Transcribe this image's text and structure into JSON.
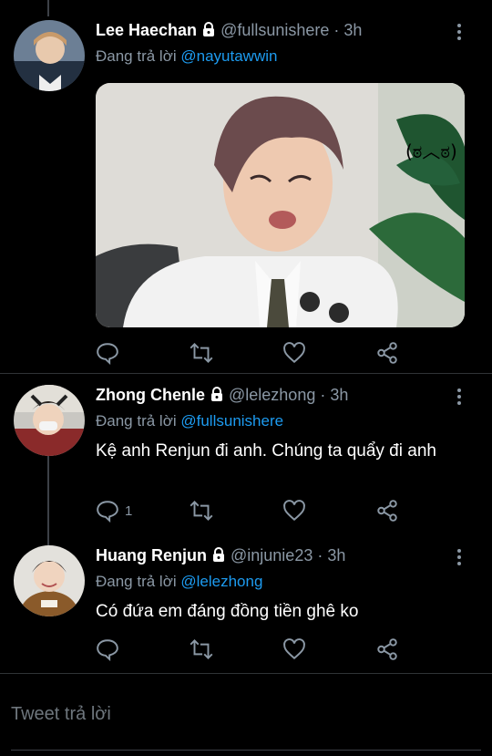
{
  "tweets": [
    {
      "name": "Lee Haechan",
      "handle": "@fullsunishere",
      "time": "· 3h",
      "reply_prefix": "Đang trả lời",
      "reply_to": "@nayutawwin",
      "text": "",
      "media_caption": "(ಠ︿ಠ)",
      "reply_count": ""
    },
    {
      "name": "Zhong Chenle",
      "handle": "@lelezhong",
      "time": "· 3h",
      "reply_prefix": "Đang trả lời",
      "reply_to": "@fullsunishere",
      "text": "Kệ anh Renjun đi anh. Chúng ta quẩy đi anh",
      "reply_count": "1"
    },
    {
      "name": "Huang Renjun",
      "handle": "@injunie23",
      "time": "· 3h",
      "reply_prefix": "Đang trả lời",
      "reply_to": "@lelezhong",
      "text": "Có đứa em đáng đồng tiền ghê ko",
      "reply_count": ""
    }
  ],
  "compose": {
    "placeholder": "Tweet trả lời"
  },
  "icons": {
    "reply": "reply-icon",
    "retweet": "retweet-icon",
    "like": "heart-icon",
    "share": "share-icon",
    "lock": "lock-icon",
    "more": "more-icon"
  },
  "colors": {
    "background": "#000000",
    "link": "#1d9bf0",
    "muted": "#8b98a5"
  }
}
